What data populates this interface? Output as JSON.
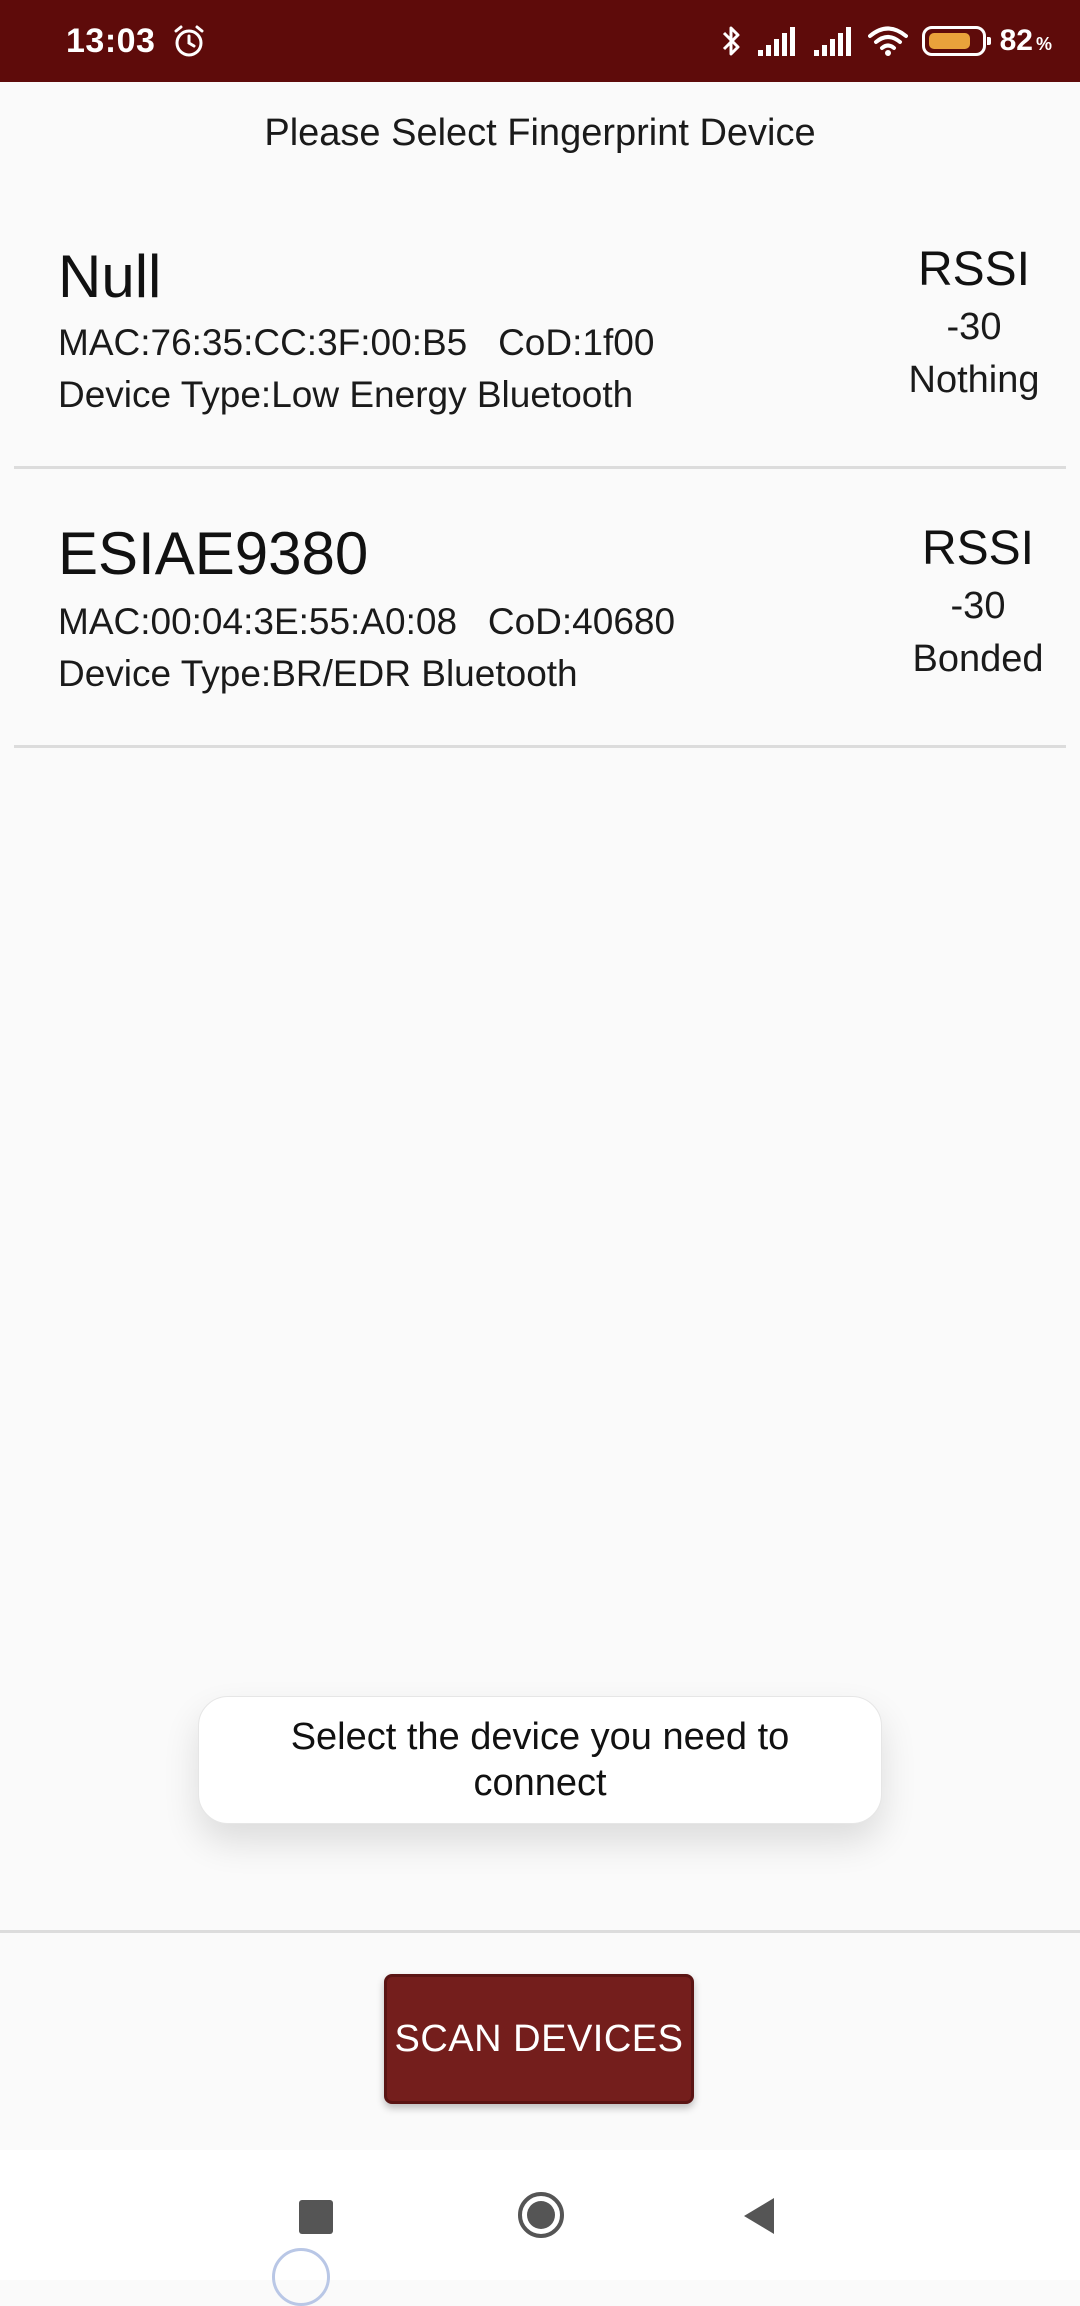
{
  "status_bar": {
    "time": "13:03",
    "battery_percent": "82",
    "battery_level": 0.82,
    "battery_color": "#e9a23b",
    "icons": [
      "alarm-icon",
      "bluetooth-icon",
      "signal-icon",
      "signal-icon",
      "wifi-icon",
      "battery-icon"
    ]
  },
  "header": {
    "title": "Please Select Fingerprint Device"
  },
  "devices": [
    {
      "name": "Null",
      "mac_cod": "MAC:76:35:CC:3F:00:B5   CoD:1f00",
      "device_type": "Device Type:Low Energy Bluetooth",
      "rssi_label": "RSSI",
      "rssi_value": "-30",
      "bond_status": "Nothing"
    },
    {
      "name": "ESIAE9380",
      "mac_cod": "MAC:00:04:3E:55:A0:08   CoD:40680",
      "device_type": "Device Type:BR/EDR Bluetooth",
      "rssi_label": "RSSI",
      "rssi_value": "-30",
      "bond_status": "Bonded"
    }
  ],
  "toast": {
    "text": "Select the device you need to connect"
  },
  "scan_button": {
    "label": "SCAN DEVICES",
    "color": "#741e1c"
  },
  "nav_bar": {
    "icons": [
      "recents-icon",
      "home-icon",
      "back-icon"
    ]
  },
  "colors": {
    "status_bar_bg": "#5e0b0a",
    "page_bg": "#fafafa"
  }
}
